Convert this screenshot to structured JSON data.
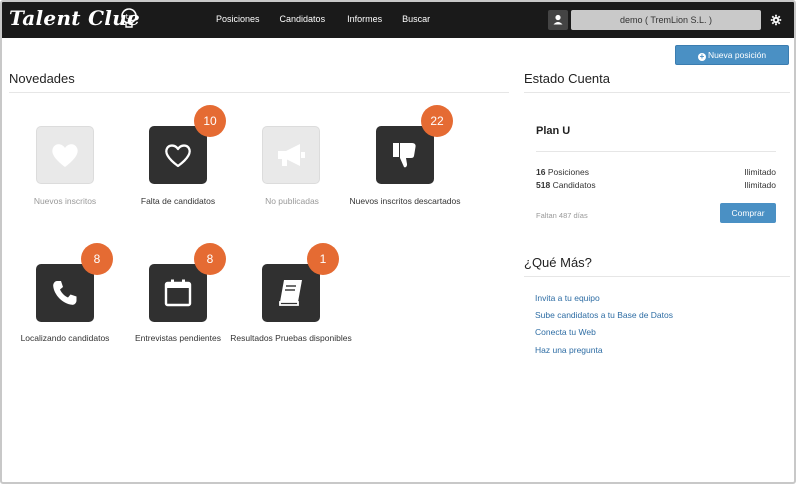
{
  "navbar": {
    "logo": "Talent Clue",
    "links": [
      "Posiciones",
      "Candidatos",
      "Informes",
      "Buscar"
    ],
    "user_account": "demo ( TremLion S.L. )"
  },
  "actions": {
    "new_position_label": "Nueva posición"
  },
  "novedades": {
    "title": "Novedades",
    "tiles": [
      {
        "label": "Nuevos inscritos",
        "badge": "",
        "icon": "heart-icon",
        "active": false
      },
      {
        "label": "Falta de candidatos",
        "badge": "10",
        "icon": "heart-icon",
        "active": true
      },
      {
        "label": "No publicadas",
        "badge": "",
        "icon": "megaphone-icon",
        "active": false
      },
      {
        "label": "Nuevos inscritos descartados",
        "badge": "22",
        "icon": "thumbs-down-icon",
        "active": true
      },
      {
        "label": "Localizando candidatos",
        "badge": "8",
        "icon": "phone-icon",
        "active": true
      },
      {
        "label": "Entrevistas pendientes",
        "badge": "8",
        "icon": "calendar-icon",
        "active": true
      },
      {
        "label": "Resultados Pruebas disponibles",
        "badge": "1",
        "icon": "book-icon",
        "active": true
      }
    ]
  },
  "estado": {
    "title": "Estado Cuenta",
    "plan": "Plan U",
    "posiciones_count": "16",
    "posiciones_label": "Posiciones",
    "posiciones_limit": "Ilimitado",
    "candidatos_count": "518",
    "candidatos_label": "Candidatos",
    "candidatos_limit": "Ilimitado",
    "faltan": "Faltan 487 días",
    "buy_label": "Comprar"
  },
  "que_mas": {
    "title": "¿Qué Más?",
    "links": [
      "Invita a tu equipo",
      "Sube candidatos a tu Base de Datos",
      "Conecta tu Web",
      "Haz una pregunta"
    ]
  },
  "colors": {
    "navbar": "#1a1a1a",
    "accent_blue": "#4a90c4",
    "badge_orange": "#e56b33",
    "tile_dark": "#303030",
    "link": "#2e6da4"
  }
}
